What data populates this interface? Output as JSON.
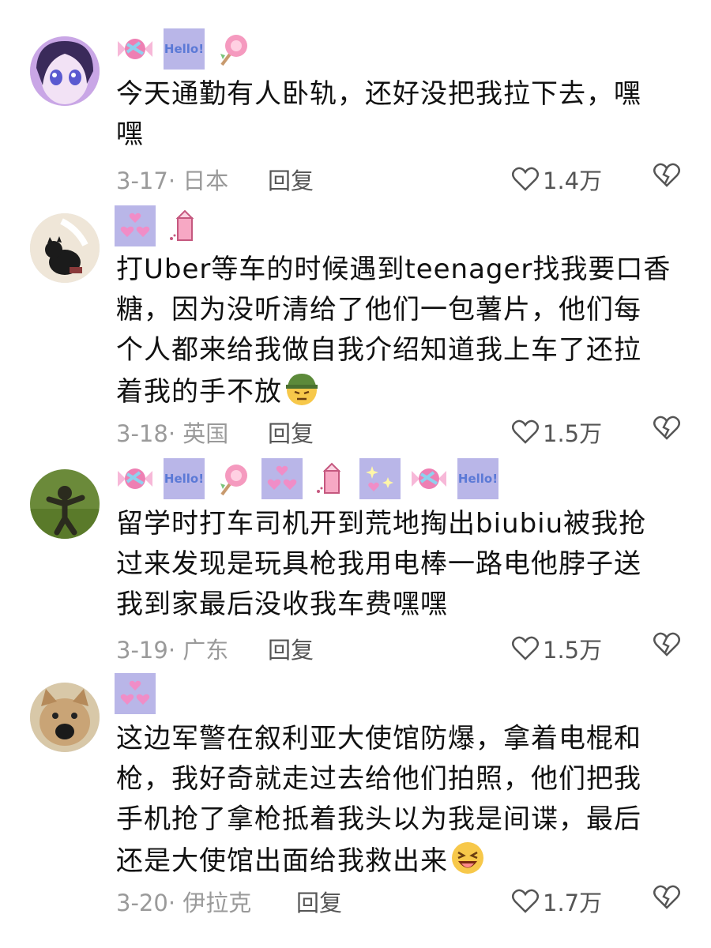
{
  "comments": [
    {
      "text_lines": [
        "今天通勤有人卧轨，还好没把我拉下去，嘿",
        "嘿"
      ],
      "date": "3-17",
      "location": "日本",
      "reply_label": "回复",
      "likes": "1.4万",
      "stickers": [
        "candy",
        "hello",
        "lollipop"
      ]
    },
    {
      "text_lines": [
        "打Uber等车的时候遇到teenager找我要口香",
        "糖，因为没听清给了他们一包薯片，他们每",
        "个人都来给我做自我介绍知道我上车了还拉",
        "着我的手不放"
      ],
      "date": "3-18",
      "location": "英国",
      "reply_label": "回复",
      "likes": "1.5万",
      "stickers": [
        "hearts",
        "milk"
      ],
      "emoji": "salute-face-emoji"
    },
    {
      "text_lines": [
        "留学时打车司机开到荒地掏出biubiu被我抢",
        "过来发现是玩具枪我用电棒一路电他脖子送",
        "我到家最后没收我车费嘿嘿"
      ],
      "date": "3-19",
      "location": "广东",
      "reply_label": "回复",
      "likes": "1.5万",
      "stickers": [
        "candy",
        "hello",
        "lollipop",
        "hearts",
        "milk",
        "sparkles",
        "candy",
        "hello"
      ]
    },
    {
      "text_lines": [
        "这边军警在叙利亚大使馆防爆，拿着电棍和",
        "枪，我好奇就走过去给他们拍照，他们把我",
        "手机抢了拿枪抵着我头以为我是间谍，最后",
        "还是大使馆出面给我救出来"
      ],
      "date": "3-20",
      "location": "伊拉克",
      "reply_label": "回复",
      "likes": "1.7万",
      "stickers": [
        "hearts"
      ],
      "emoji": "laughing-face-emoji"
    }
  ],
  "sticker_hello_text": "Hello!",
  "colors": {
    "sticker_bg": "#b9b6e8",
    "text": "#111111",
    "meta": "#9a9a9a"
  }
}
